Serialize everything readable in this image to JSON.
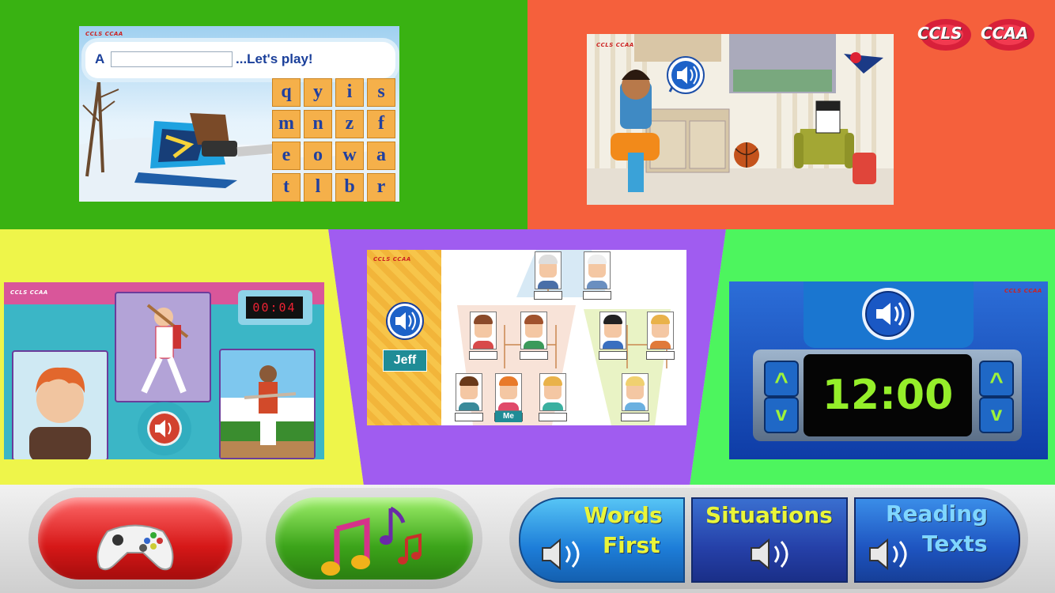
{
  "branding": {
    "logo_left": "CCLS",
    "logo_right": "CCAA"
  },
  "word_game": {
    "prompt_prefix": "A",
    "prompt_suffix": "...Let's play!",
    "letters": [
      "q",
      "y",
      "i",
      "s",
      "m",
      "n",
      "z",
      "f",
      "e",
      "o",
      "w",
      "a",
      "t",
      "l",
      "b",
      "r"
    ]
  },
  "family_tree": {
    "speaker_label": "Jeff",
    "me_label": "Me"
  },
  "baseball": {
    "timer": "00:04"
  },
  "clock": {
    "time": "12:00",
    "up_symbol": "^",
    "down_symbol": "v"
  },
  "bottom_bar": {
    "words_first_line1": "Words",
    "words_first_line2": "First",
    "situations": "Situations",
    "reading_line1": "Reading",
    "reading_line2": "Texts"
  },
  "colors": {
    "green": "#39b212",
    "orange": "#f5603c",
    "yellow": "#eef54a",
    "purple": "#a05cf0",
    "light_green": "#4df55e",
    "label_yellow": "#e9f53a"
  }
}
